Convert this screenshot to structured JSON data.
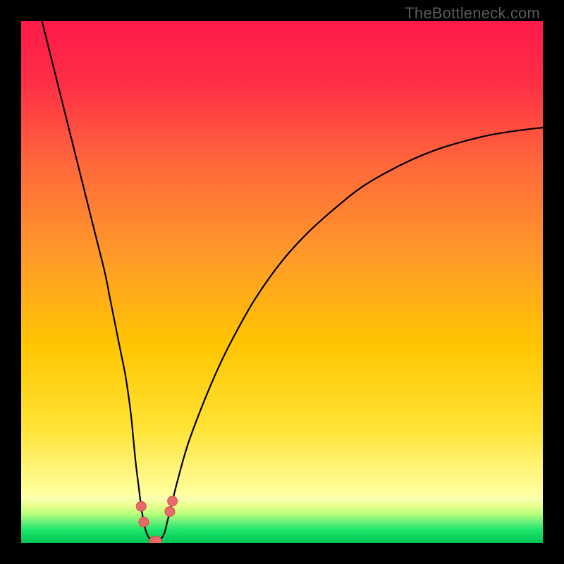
{
  "watermark": "TheBottleneck.com",
  "chart_data": {
    "type": "line",
    "title": "",
    "xlabel": "",
    "ylabel": "",
    "xlim": [
      0,
      100
    ],
    "ylim": [
      0,
      100
    ],
    "x": [
      4.0,
      6.0,
      8.0,
      10.0,
      12.0,
      14.0,
      16.0,
      17.0,
      18.0,
      19.0,
      20.0,
      21.0,
      21.5,
      22.0,
      22.5,
      23.0,
      23.5,
      24.0,
      24.5,
      25.0,
      25.5,
      26.0,
      26.5,
      27.0,
      27.5,
      28.0,
      28.5,
      29.0,
      30.0,
      32.0,
      35.0,
      38.0,
      41.0,
      45.0,
      50.0,
      55.0,
      60.0,
      65.0,
      70.0,
      75.0,
      80.0,
      85.0,
      90.0,
      95.0,
      100.0
    ],
    "values": [
      100.0,
      92.0,
      84.0,
      76.0,
      68.0,
      60.0,
      52.0,
      47.0,
      42.0,
      37.0,
      32.0,
      25.0,
      20.0,
      15.0,
      11.0,
      7.0,
      4.0,
      2.0,
      1.0,
      0.5,
      0.3,
      0.3,
      0.5,
      1.0,
      2.0,
      4.0,
      6.0,
      8.0,
      12.0,
      19.0,
      27.0,
      34.0,
      40.0,
      47.0,
      54.0,
      59.5,
      64.0,
      68.0,
      71.0,
      73.5,
      75.5,
      77.0,
      78.2,
      79.0,
      79.6
    ],
    "highlight_band_y": [
      0,
      8
    ],
    "minimum_x_approx": 25.5,
    "note": "Values estimated from pixel positions; y is percent-of-height from bottom, x is percent-of-width from left of the colored plot region."
  },
  "colors": {
    "top": "#ff1a4a",
    "mid": "#ffc500",
    "pale": "#ffff9e",
    "band_light": "#e7ff8c",
    "band_green": "#00e565",
    "band_green_dark": "#00c455",
    "curve": "#000000",
    "marker": "#e86a6a",
    "marker_stroke": "#d94f4f"
  }
}
